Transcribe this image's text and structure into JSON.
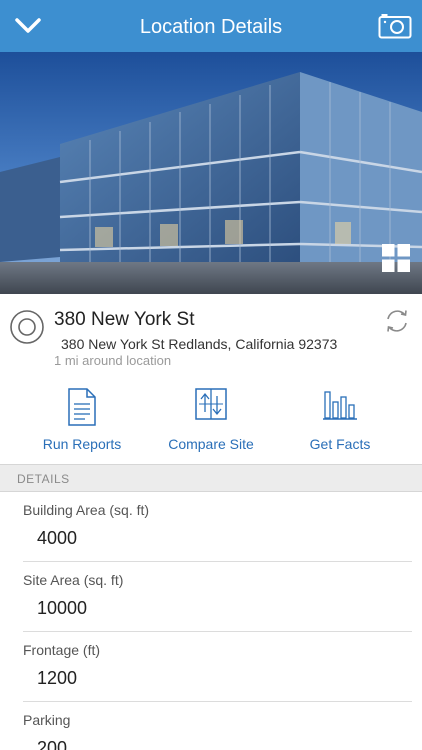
{
  "header": {
    "title": "Location Details",
    "back_icon": "chevron-down-icon",
    "camera_icon": "camera-icon"
  },
  "colors": {
    "header_bg": "#3d8fd0",
    "accent": "#2a6fb8"
  },
  "location": {
    "name": "380 New York St",
    "address": "380 New York St Redlands, California 92373",
    "radius": "1 mi around location"
  },
  "actions": [
    {
      "label": "Run Reports",
      "icon": "report-icon"
    },
    {
      "label": "Compare Site",
      "icon": "compare-icon"
    },
    {
      "label": "Get Facts",
      "icon": "bar-chart-icon"
    }
  ],
  "details": {
    "section_title": "DETAILS",
    "fields": [
      {
        "label": "Building Area (sq. ft)",
        "value": "4000"
      },
      {
        "label": "Site Area (sq. ft)",
        "value": "10000"
      },
      {
        "label": "Frontage (ft)",
        "value": "1200"
      },
      {
        "label": "Parking",
        "value": "200"
      }
    ]
  }
}
